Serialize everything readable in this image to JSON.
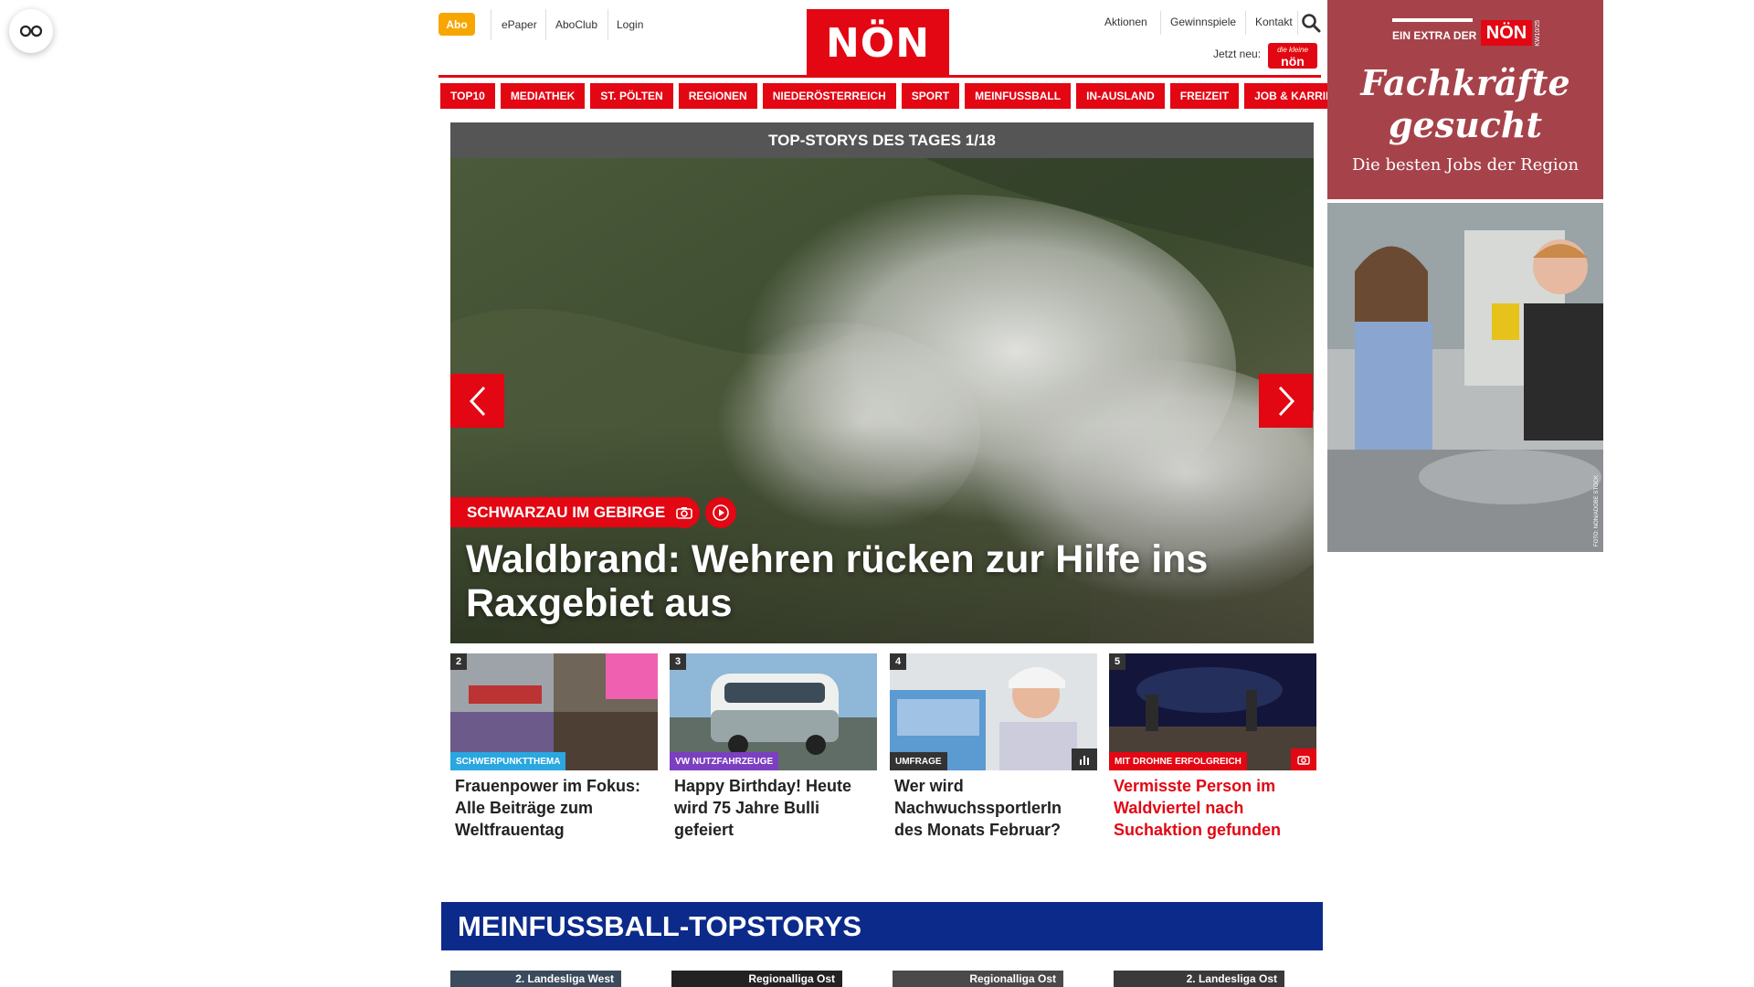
{
  "header": {
    "abo_label": "Abo",
    "links_left": [
      "ePaper",
      "AboClub",
      "Login"
    ],
    "logo_text": "NÖN",
    "links_right": [
      "Aktionen",
      "Gewinnspiele",
      "Kontakt"
    ],
    "jetzt_label": "Jetzt neu:",
    "mini_logo_line1": "die kleine",
    "mini_logo_line2": "nön"
  },
  "nav": [
    "TOP10",
    "MEDIATHEK",
    "ST. PÖLTEN",
    "REGIONEN",
    "NIEDERÖSTERREICH",
    "SPORT",
    "MEINFUSSBALL",
    "IN-AUSLAND",
    "FREIZEIT",
    "JOB & KARRIERE"
  ],
  "hero": {
    "header": "TOP-STORYS DES TAGES 1/18",
    "tag": "SCHWARZAU IM GEBIRGE",
    "title": "Waldbrand: Wehren rücken zur Hilfe ins Raxgebiet aus"
  },
  "teasers": [
    {
      "num": "2",
      "tag": "SCHWERPUNKTTHEMA",
      "tag_color": "#2aa7e0",
      "title": "Frauenpower im Fokus: Alle Beiträge zum Weltfrauentag",
      "title_color": "#222222"
    },
    {
      "num": "3",
      "tag": "VW NUTZFAHRZEUGE",
      "tag_color": "#7b3fc0",
      "title": "Happy Birthday! Heute wird 75 Jahre Bulli gefeiert",
      "title_color": "#222222"
    },
    {
      "num": "4",
      "tag": "UMFRAGE",
      "tag_color": "#333333",
      "title": "Wer wird NachwuchssportlerIn des Monats Februar?",
      "title_color": "#222222"
    },
    {
      "num": "5",
      "tag": "MIT DROHNE ERFOLGREICH",
      "tag_color": "#e30613",
      "title": "Vermisste Person im Waldviertel nach Suchaktion gefunden",
      "title_color": "#e30613"
    }
  ],
  "meinfussball": {
    "title": "MEINFUSSBALL-TOPSTORYS",
    "cards": [
      "2. Landesliga West",
      "Regionalliga Ost",
      "Regionalliga Ost",
      "2. Landesliga Ost"
    ]
  },
  "ad": {
    "extra_label": "EIN EXTRA DER",
    "logo": "NÖN",
    "side_text": "KW10/25",
    "headline_line1": "Fachkräfte",
    "headline_line2": "gesucht",
    "subline": "Die besten Jobs der Region",
    "photo_credit": "FOTO: NÖN/ADOBE STOCK"
  },
  "colors": {
    "brand_red": "#e30613",
    "abo_orange": "#f7a600",
    "meinfussball_blue": "#0c2a8a",
    "ad_red": "#a6424a"
  }
}
